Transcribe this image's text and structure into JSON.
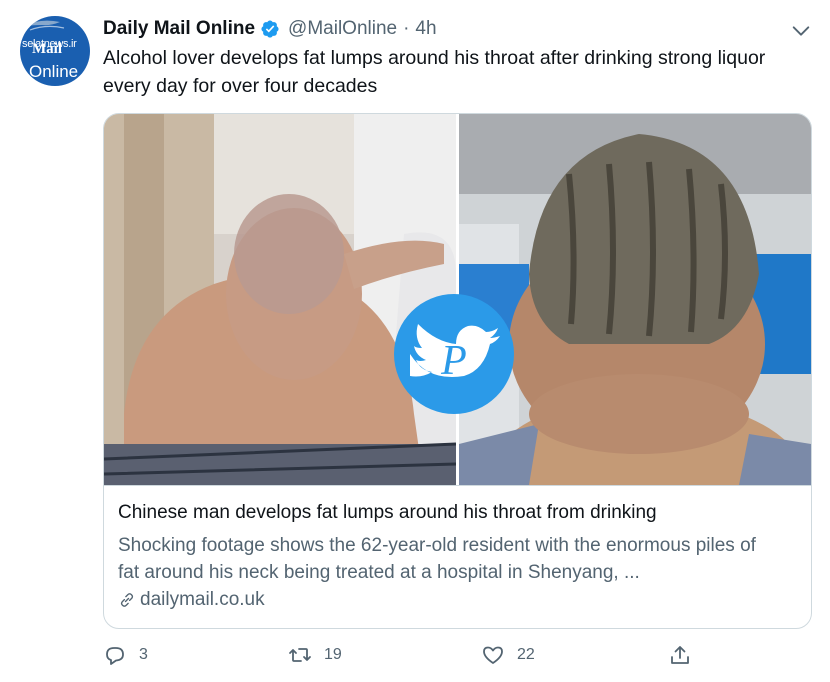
{
  "avatar": {
    "watermark_site": "selatnews.ir",
    "brand_top": "Mail",
    "brand_bottom": "Online"
  },
  "tweet": {
    "name": "Daily Mail Online",
    "handle": "@MailOnline",
    "separator": "·",
    "time": "4h",
    "text": "Alcohol lover develops fat lumps around his throat after drinking strong liquor every day for over four decades"
  },
  "card": {
    "title": "Chinese man develops fat lumps around his throat from drinking",
    "description": "Shocking footage shows the 62-year-old resident with the enormous piles of fat around his neck being treated at a hospital in Shenyang, ...",
    "domain": "dailymail.co.uk",
    "watermark_letter": "P"
  },
  "actions": {
    "replies": "3",
    "retweets": "19",
    "likes": "22"
  },
  "colors": {
    "accent": "#1d9bf0",
    "secondary_text": "#536471",
    "border": "#cfd9de"
  },
  "icons": [
    "verified-badge-icon",
    "chevron-down-icon",
    "link-icon",
    "reply-icon",
    "retweet-icon",
    "like-icon",
    "share-icon"
  ]
}
